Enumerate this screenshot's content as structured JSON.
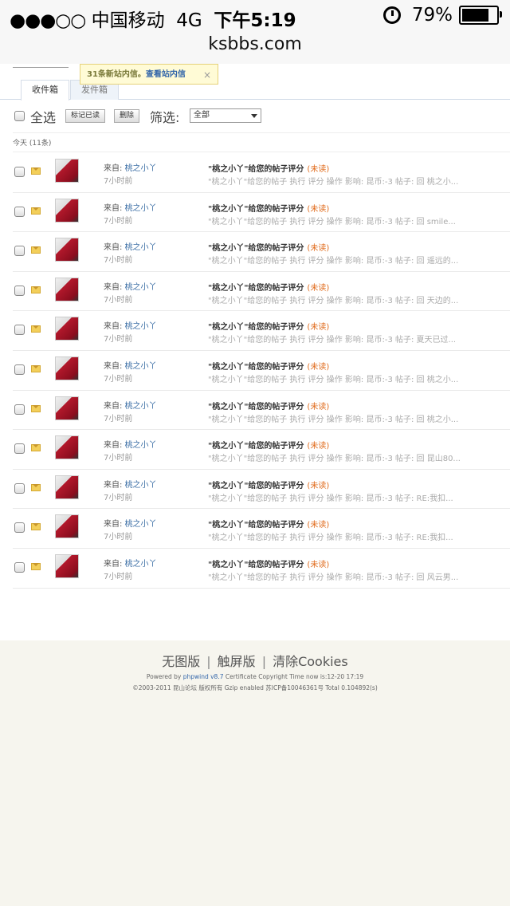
{
  "status_bar": {
    "signal_dots": "●●●○○",
    "carrier": "中国移动",
    "network": "4G",
    "time": "下午5:19",
    "battery_percent": "79%",
    "battery_level": 0.79,
    "alarm_icon": "alarm-clock-icon"
  },
  "browser": {
    "url": "ksbbs.com"
  },
  "notice": {
    "count_text": "31条新站内信。",
    "link": "查看站内信",
    "close": "×"
  },
  "tabs": [
    {
      "label": "收件箱",
      "active": true
    },
    {
      "label": "发件箱",
      "active": false
    }
  ],
  "toolbar": {
    "select_all": "全选",
    "mark_read": "标记已读",
    "delete": "删除",
    "filter_label": "筛选:",
    "filter_value": "全部"
  },
  "day_header": "今天 (11条)",
  "messages": [
    {
      "from_label": "来自:",
      "user": "桃之小丫",
      "time": "7小时前",
      "subject": "\"桃之小丫\"给您的帖子评分",
      "status": "(未读)",
      "summary": "\"桃之小丫\"给您的帖子 执行 评分 操作 影响: 昆币:-3 帖子: 回 桃之小..."
    },
    {
      "from_label": "来自:",
      "user": "桃之小丫",
      "time": "7小时前",
      "subject": "\"桃之小丫\"给您的帖子评分",
      "status": "(未读)",
      "summary": "\"桃之小丫\"给您的帖子 执行 评分 操作 影响: 昆币:-3 帖子: 回 smile..."
    },
    {
      "from_label": "来自:",
      "user": "桃之小丫",
      "time": "7小时前",
      "subject": "\"桃之小丫\"给您的帖子评分",
      "status": "(未读)",
      "summary": "\"桃之小丫\"给您的帖子 执行 评分 操作 影响: 昆币:-3 帖子: 回 遥远的..."
    },
    {
      "from_label": "来自:",
      "user": "桃之小丫",
      "time": "7小时前",
      "subject": "\"桃之小丫\"给您的帖子评分",
      "status": "(未读)",
      "summary": "\"桃之小丫\"给您的帖子 执行 评分 操作 影响: 昆币:-3 帖子: 回 天边的..."
    },
    {
      "from_label": "来自:",
      "user": "桃之小丫",
      "time": "7小时前",
      "subject": "\"桃之小丫\"给您的帖子评分",
      "status": "(未读)",
      "summary": "\"桃之小丫\"给您的帖子 执行 评分 操作 影响: 昆币:-3 帖子: 夏天已过..."
    },
    {
      "from_label": "来自:",
      "user": "桃之小丫",
      "time": "7小时前",
      "subject": "\"桃之小丫\"给您的帖子评分",
      "status": "(未读)",
      "summary": "\"桃之小丫\"给您的帖子 执行 评分 操作 影响: 昆币:-3 帖子: 回 桃之小..."
    },
    {
      "from_label": "来自:",
      "user": "桃之小丫",
      "time": "7小时前",
      "subject": "\"桃之小丫\"给您的帖子评分",
      "status": "(未读)",
      "summary": "\"桃之小丫\"给您的帖子 执行 评分 操作 影响: 昆币:-3 帖子: 回 桃之小..."
    },
    {
      "from_label": "来自:",
      "user": "桃之小丫",
      "time": "7小时前",
      "subject": "\"桃之小丫\"给您的帖子评分",
      "status": "(未读)",
      "summary": "\"桃之小丫\"给您的帖子 执行 评分 操作 影响: 昆币:-3 帖子: 回 昆山80..."
    },
    {
      "from_label": "来自:",
      "user": "桃之小丫",
      "time": "7小时前",
      "subject": "\"桃之小丫\"给您的帖子评分",
      "status": "(未读)",
      "summary": "\"桃之小丫\"给您的帖子 执行 评分 操作 影响: 昆币:-3 帖子: RE:我扣..."
    },
    {
      "from_label": "来自:",
      "user": "桃之小丫",
      "time": "7小时前",
      "subject": "\"桃之小丫\"给您的帖子评分",
      "status": "(未读)",
      "summary": "\"桃之小丫\"给您的帖子 执行 评分 操作 影响: 昆币:-3 帖子: RE:我扣..."
    },
    {
      "from_label": "来自:",
      "user": "桃之小丫",
      "time": "7小时前",
      "subject": "\"桃之小丫\"给您的帖子评分",
      "status": "(未读)",
      "summary": "\"桃之小丫\"给您的帖子 执行 评分 操作 影响: 昆币:-3 帖子: 回 风云男..."
    }
  ],
  "footer": {
    "links": [
      "无图版",
      "触屏版",
      "清除Cookies"
    ],
    "separator": "|",
    "powered_prefix": "Powered by",
    "powered_brand": "phpwind v8.7",
    "powered_suffix": "Certificate Copyright Time now is:12-20 17:19",
    "copyright": "©2003-2011 昆山论坛 版权所有 Gzip enabled 苏ICP备10046361号 Total 0.104892(s)"
  }
}
